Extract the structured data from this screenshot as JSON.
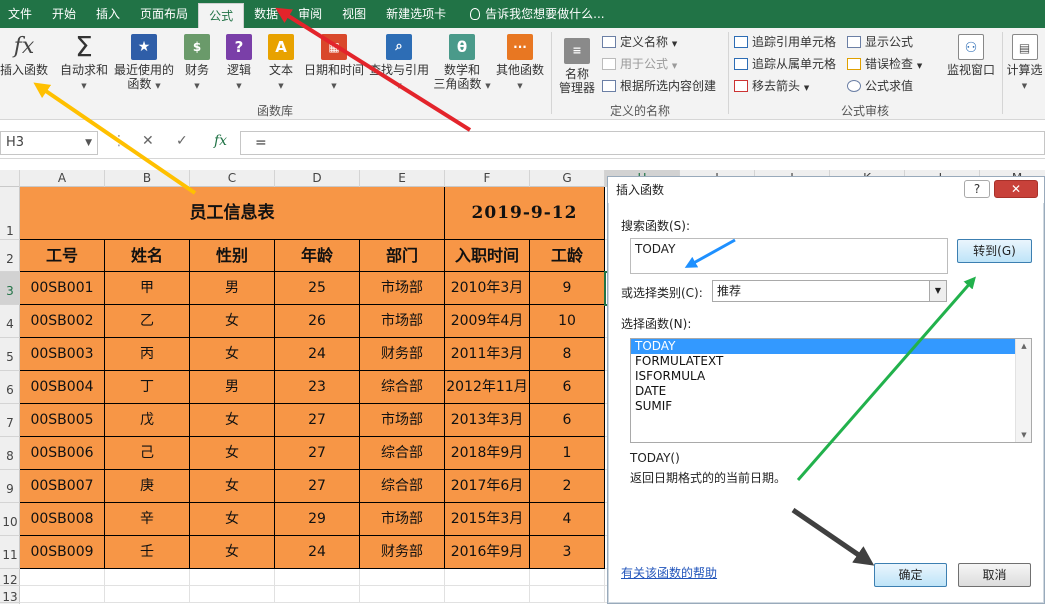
{
  "tabs": [
    {
      "label": "文件"
    },
    {
      "label": "开始"
    },
    {
      "label": "插入"
    },
    {
      "label": "页面布局"
    },
    {
      "label": "公式"
    },
    {
      "label": "数据"
    },
    {
      "label": "审阅"
    },
    {
      "label": "视图"
    },
    {
      "label": "新建选项卡"
    }
  ],
  "tell_me": "告诉我您想要做什么...",
  "ribbon": {
    "function_library": {
      "insert_function": "插入函数",
      "autosum": "自动求和",
      "recently_used_1": "最近使用的",
      "recently_used_2": "函数",
      "financial": "财务",
      "logical": "逻辑",
      "text": "文本",
      "datetime": "日期和时间",
      "lookup": "查找与引用",
      "math_1": "数学和",
      "math_2": "三角函数",
      "other": "其他函数",
      "group_label": "函数库"
    },
    "defined_names": {
      "name_manager_1": "名称",
      "name_manager_2": "管理器",
      "define_name": "定义名称",
      "use_in_formula": "用于公式",
      "create_from_selection": "根据所选内容创建",
      "group_label": "定义的名称"
    },
    "auditing": {
      "trace_precedents": "追踪引用单元格",
      "trace_dependents": "追踪从属单元格",
      "remove_arrows": "移去箭头",
      "show_formulas": "显示公式",
      "error_checking": "错误检查",
      "evaluate_formula": "公式求值",
      "watch_window": "监视窗口",
      "group_label": "公式审核"
    },
    "calculation": {
      "options": "计算选"
    }
  },
  "formula_bar": {
    "name_box": "H3",
    "formula": "="
  },
  "sheet": {
    "columns": [
      "A",
      "B",
      "C",
      "D",
      "E",
      "F",
      "G",
      "H",
      "I",
      "J",
      "K",
      "L",
      "M"
    ],
    "rows": [
      "1",
      "2",
      "3",
      "4",
      "5",
      "6",
      "7",
      "8",
      "9",
      "10",
      "11",
      "12",
      "13"
    ],
    "title": "员工信息表",
    "date": "2019-9-12",
    "headers": [
      "工号",
      "姓名",
      "性别",
      "年龄",
      "部门",
      "入职时间",
      "工龄"
    ],
    "data": [
      [
        "00SB001",
        "甲",
        "男",
        "25",
        "市场部",
        "2010年3月",
        "9"
      ],
      [
        "00SB002",
        "乙",
        "女",
        "26",
        "市场部",
        "2009年4月",
        "10"
      ],
      [
        "00SB003",
        "丙",
        "女",
        "24",
        "财务部",
        "2011年3月",
        "8"
      ],
      [
        "00SB004",
        "丁",
        "男",
        "23",
        "综合部",
        "2012年11月",
        "6"
      ],
      [
        "00SB005",
        "戊",
        "女",
        "27",
        "市场部",
        "2013年3月",
        "6"
      ],
      [
        "00SB006",
        "己",
        "女",
        "27",
        "综合部",
        "2018年9月",
        "1"
      ],
      [
        "00SB007",
        "庚",
        "女",
        "27",
        "综合部",
        "2017年6月",
        "2"
      ],
      [
        "00SB008",
        "辛",
        "女",
        "29",
        "市场部",
        "2015年3月",
        "4"
      ],
      [
        "00SB009",
        "壬",
        "女",
        "24",
        "财务部",
        "2016年9月",
        "3"
      ]
    ]
  },
  "dialog": {
    "title": "插入函数",
    "search_label": "搜索函数(S):",
    "search_value": "TODAY",
    "go_button": "转到(G)",
    "category_label": "或选择类别(C):",
    "category_value": "推荐",
    "select_label": "选择函数(N):",
    "functions": [
      "TODAY",
      "FORMULATEXT",
      "ISFORMULA",
      "DATE",
      "SUMIF"
    ],
    "signature": "TODAY()",
    "description": "返回日期格式的的当前日期。",
    "help_link": "有关该函数的帮助",
    "ok": "确定",
    "cancel": "取消"
  },
  "colors": {
    "excel_green": "#217346",
    "cell_orange": "#f79646",
    "arrow_red": "#e3242b",
    "arrow_yellow": "#ffc000",
    "arrow_blue": "#1e90ff",
    "arrow_green": "#22b14c",
    "arrow_black": "#404040"
  }
}
